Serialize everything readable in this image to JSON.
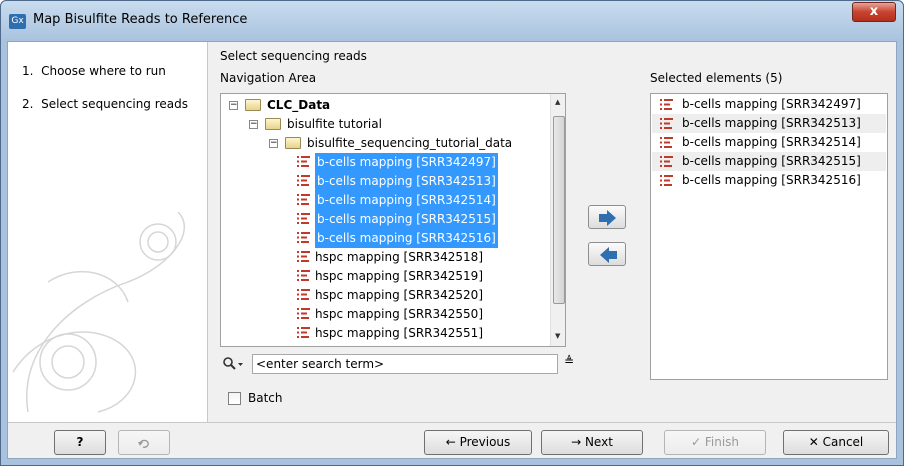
{
  "window": {
    "app_icon_text": "Gx",
    "title": "Map Bisulfite Reads to Reference",
    "close_label": "x"
  },
  "steps": [
    {
      "number": "1.",
      "label": "Choose where to run"
    },
    {
      "number": "2.",
      "label": "Select sequencing reads"
    }
  ],
  "content": {
    "header": "Select sequencing reads",
    "navigation_label": "Navigation Area",
    "selected_label": "Selected elements (5)"
  },
  "tree": {
    "root": "CLC_Data",
    "folder1": "bisulfite tutorial",
    "folder2": "bisulfite_sequencing_tutorial_data",
    "items": [
      "b-cells mapping [SRR342497]",
      "b-cells mapping [SRR342513]",
      "b-cells mapping [SRR342514]",
      "b-cells mapping [SRR342515]",
      "b-cells mapping [SRR342516]",
      "hspc mapping [SRR342518]",
      "hspc mapping [SRR342519]",
      "hspc mapping [SRR342520]",
      "hspc mapping [SRR342550]",
      "hspc mapping [SRR342551]"
    ],
    "selected_count": 5
  },
  "selected": [
    "b-cells mapping [SRR342497]",
    "b-cells mapping [SRR342513]",
    "b-cells mapping [SRR342514]",
    "b-cells mapping [SRR342515]",
    "b-cells mapping [SRR342516]"
  ],
  "search": {
    "placeholder": "<enter search term>"
  },
  "batch_label": "Batch",
  "buttons": {
    "help": "?",
    "previous": "Previous",
    "next": "Next",
    "finish": "Finish",
    "cancel": "Cancel"
  },
  "colors": {
    "selection": "#3399ff",
    "seq_icon": "#c0392b",
    "arrow_blue": "#2f6fb0"
  }
}
